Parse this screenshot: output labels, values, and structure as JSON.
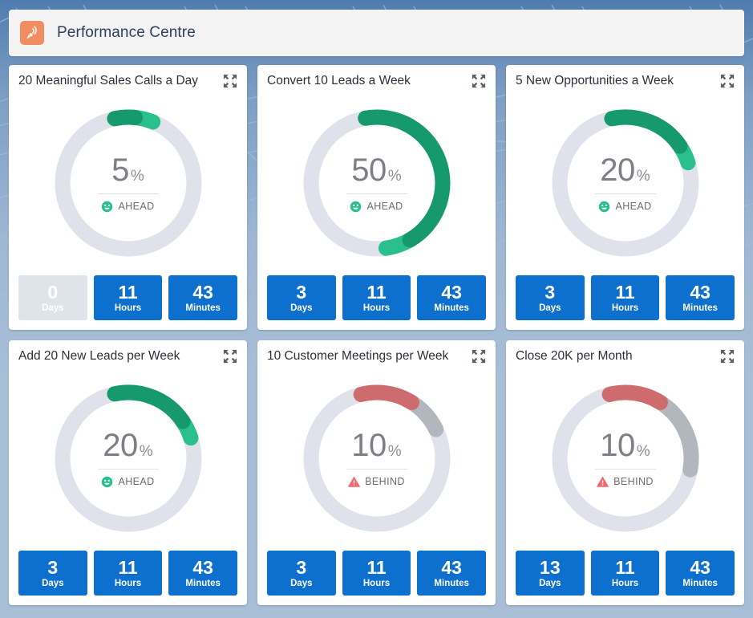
{
  "header": {
    "title": "Performance Centre",
    "brand_icon": "satellite-dish-icon",
    "brand_icon_bg": "#f08e62"
  },
  "theme": {
    "page_bg": "#4f7cae",
    "card_bg": "#ffffff",
    "track": "#dfe2ea",
    "arc_green_dark": "#16996c",
    "arc_green_light": "#2ac08e",
    "arc_red": "#cd6b6f",
    "arc_gray": "#b2b6bd",
    "timer_blue": "#0d6fce",
    "timer_inactive": "#dfe3ea"
  },
  "labels": {
    "expand_icon": "expand-icon",
    "percent_sign": "%",
    "ahead_icon": "smiley-ahead-icon",
    "behind_icon": "warning-behind-icon",
    "days": "Days",
    "hours": "Hours",
    "minutes": "Minutes"
  },
  "cards": [
    {
      "title": "20 Meaningful Sales Calls a Day",
      "percent": 5,
      "percent_text": "5",
      "status": "AHEAD",
      "status_type": "ahead",
      "arc_start_deg": -12,
      "arc_main_deg": 18,
      "arc_tip_deg": 16,
      "arc_gray_deg": 0,
      "timers": [
        {
          "value": "0",
          "label": "Days",
          "active": false
        },
        {
          "value": "11",
          "label": "Hours",
          "active": true
        },
        {
          "value": "43",
          "label": "Minutes",
          "active": true
        }
      ]
    },
    {
      "title": "Convert 10 Leads a Week",
      "percent": 50,
      "percent_text": "50",
      "status": "AHEAD",
      "status_type": "ahead",
      "arc_start_deg": -10,
      "arc_main_deg": 160,
      "arc_tip_deg": 22,
      "arc_gray_deg": 0,
      "timers": [
        {
          "value": "3",
          "label": "Days",
          "active": true
        },
        {
          "value": "11",
          "label": "Hours",
          "active": true
        },
        {
          "value": "43",
          "label": "Minutes",
          "active": true
        }
      ]
    },
    {
      "title": "5 New Opportunities a Week",
      "percent": 20,
      "percent_text": "20",
      "status": "AHEAD",
      "status_type": "ahead",
      "arc_start_deg": -12,
      "arc_main_deg": 68,
      "arc_tip_deg": 16,
      "arc_gray_deg": 0,
      "timers": [
        {
          "value": "3",
          "label": "Days",
          "active": true
        },
        {
          "value": "11",
          "label": "Hours",
          "active": true
        },
        {
          "value": "43",
          "label": "Minutes",
          "active": true
        }
      ]
    },
    {
      "title": "Add 20 New Leads per Week",
      "percent": 20,
      "percent_text": "20",
      "status": "AHEAD",
      "status_type": "ahead",
      "arc_start_deg": -12,
      "arc_main_deg": 68,
      "arc_tip_deg": 16,
      "arc_gray_deg": 0,
      "timers": [
        {
          "value": "3",
          "label": "Days",
          "active": true
        },
        {
          "value": "11",
          "label": "Hours",
          "active": true
        },
        {
          "value": "43",
          "label": "Minutes",
          "active": true
        }
      ]
    },
    {
      "title": "10 Customer Meetings per Week",
      "percent": 10,
      "percent_text": "10",
      "status": "BEHIND",
      "status_type": "behind",
      "arc_start_deg": -14,
      "arc_main_deg": 46,
      "arc_tip_deg": 0,
      "arc_gray_deg": 32,
      "timers": [
        {
          "value": "3",
          "label": "Days",
          "active": true
        },
        {
          "value": "11",
          "label": "Hours",
          "active": true
        },
        {
          "value": "43",
          "label": "Minutes",
          "active": true
        }
      ]
    },
    {
      "title": "Close 20K per Month",
      "percent": 10,
      "percent_text": "10",
      "status": "BEHIND",
      "status_type": "behind",
      "arc_start_deg": -14,
      "arc_main_deg": 46,
      "arc_tip_deg": 0,
      "arc_gray_deg": 68,
      "timers": [
        {
          "value": "13",
          "label": "Days",
          "active": true
        },
        {
          "value": "11",
          "label": "Hours",
          "active": true
        },
        {
          "value": "43",
          "label": "Minutes",
          "active": true
        }
      ]
    }
  ]
}
